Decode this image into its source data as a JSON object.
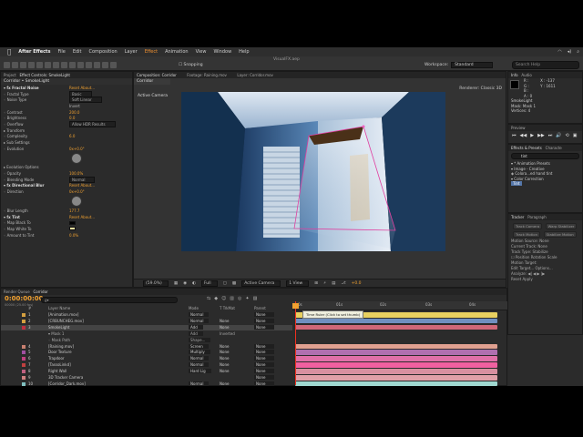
{
  "menubar": {
    "app_name": "After Effects",
    "items": [
      "File",
      "Edit",
      "Composition",
      "Layer",
      "Effect",
      "Animation",
      "View",
      "Window",
      "Help"
    ]
  },
  "toolbar": {
    "project_title": "VisualFX.aep",
    "snapping_label": "Snapping",
    "workspace_label": "Workspace:",
    "workspace_value": "Standard",
    "search_placeholder": "Search Help"
  },
  "project_panel": {
    "tabs": [
      "Project",
      "Effect Controls: SmokeLight"
    ],
    "subtitle": "Corridor • SmokeLight",
    "rows": [
      {
        "k": "▾ fx  Fractal Noise",
        "v": "Reset   About...",
        "t": "sec"
      },
      {
        "k": "   ◦ Fractal Type",
        "v": "Basic",
        "t": "drop"
      },
      {
        "k": "   ◦ Noise Type",
        "v": "Soft Linear",
        "t": "drop"
      },
      {
        "k": "",
        "v": "Invert",
        "t": "chk"
      },
      {
        "k": "   ◦ Contrast",
        "v": "200.0",
        "t": "val"
      },
      {
        "k": "   ◦ Brightness",
        "v": "0.0",
        "t": "val"
      },
      {
        "k": "   ◦ Overflow",
        "v": "Allow HDR Results",
        "t": "drop"
      },
      {
        "k": "▸ Transform",
        "v": "",
        "t": "txt"
      },
      {
        "k": "   ◦ Complexity",
        "v": "6.0",
        "t": "val"
      },
      {
        "k": "▸ Sub Settings",
        "v": "",
        "t": "txt"
      },
      {
        "k": "   ◦ Evolution",
        "v": "0x+0.0°",
        "t": "val"
      },
      {
        "k": "",
        "v": "",
        "t": "dial"
      },
      {
        "k": "▸ Evolution Options",
        "v": "",
        "t": "txt"
      },
      {
        "k": "   ◦ Opacity",
        "v": "100.0%",
        "t": "val"
      },
      {
        "k": "   ◦ Blending Mode",
        "v": "Normal",
        "t": "drop"
      },
      {
        "k": "▾ fx  Directional Blur",
        "v": "Reset   About...",
        "t": "sec"
      },
      {
        "k": "   ◦ Direction",
        "v": "0x+0.0°",
        "t": "val"
      },
      {
        "k": "",
        "v": "",
        "t": "dial"
      },
      {
        "k": "   ◦ Blur Length",
        "v": "177.7",
        "t": "val"
      },
      {
        "k": "▾ fx  Tint",
        "v": "Reset   About...",
        "t": "sec"
      },
      {
        "k": "   ◦ Map Black To",
        "v": "",
        "t": "swb"
      },
      {
        "k": "   ◦ Map White To",
        "v": "",
        "t": "sww"
      },
      {
        "k": "   ◦ Amount to Tint",
        "v": "0.0%",
        "t": "val"
      }
    ]
  },
  "viewer": {
    "tabs": [
      "Composition: Corridor",
      "Footage: Raining.mov",
      "Layer: Corridor.mov"
    ],
    "subtab": "Corridor",
    "active_camera": "Active Camera",
    "renderer": "Renderer:  Classic 3D",
    "bottom": [
      "(59.0%)",
      "Full",
      "Active Camera",
      "1 View",
      "+0.0"
    ]
  },
  "info_panel": {
    "tabs": [
      "Info",
      "Audio"
    ],
    "rows": [
      "R :",
      "G :",
      "B :",
      "A : 0",
      "X : -137",
      "Y : 1611",
      "SmokeLight",
      "Mask: Mask 1",
      "Vertices: 4"
    ]
  },
  "preview_panel": {
    "tab": "Preview",
    "controls": [
      "⏮",
      "◀◀",
      "▶",
      "▶▶",
      "⏭",
      "🔊",
      "⟲",
      "▣"
    ]
  },
  "effects_panel": {
    "tabs": [
      "Effects & Presets",
      "Characte"
    ],
    "search_value": "tint",
    "tree": [
      {
        "text": "▾ * Animation Presets",
        "sel": false
      },
      {
        "text": "   ▾ Image - Creative",
        "sel": false
      },
      {
        "text": "       ◈ Colora...ed hand tint",
        "sel": false
      },
      {
        "text": "▾ Color Correction",
        "sel": false
      },
      {
        "text": "   Tint",
        "sel": true
      }
    ]
  },
  "tracker_panel": {
    "tabs": [
      "Tracker",
      "Paragraph"
    ],
    "buttons": [
      "Track Camera",
      "Warp Stabilizer",
      "Track Motion",
      "Stabilize Motion"
    ],
    "rows": [
      "Motion Source:  None",
      "Current Track:  None",
      "Track Type:  Stabilize",
      "☐ Position   Rotation   Scale",
      "Motion Target:",
      "Edit Target...   Options...",
      "Analyze:  ◀|  ◀  ▶  |▶",
      "Reset         Apply"
    ]
  },
  "timeline": {
    "tabs": [
      "Render Queue",
      "Corridor"
    ],
    "timecode": "0:00:00:00",
    "frame_label": "00000 (25.00 fps)",
    "search_placeholder": "ϱ▾",
    "columns": [
      "#",
      "Layer Name",
      "Mode",
      "T TrkMat",
      "Parent"
    ],
    "ruler_ticks": [
      "0s",
      "01s",
      "02s",
      "03s",
      "04s"
    ],
    "tooltip": "Time Ruler (Click to set thumb)",
    "layers": [
      {
        "num": "1",
        "name": "[Animation.mov]",
        "mode": "Normal",
        "trk": "",
        "parent": "None",
        "label": "#d4a040",
        "bar": "#e8d060",
        "sel": false,
        "sub": false
      },
      {
        "num": "2",
        "name": "[CRBUNCHEG.mov]",
        "mode": "Normal",
        "trk": "None",
        "parent": "None",
        "label": "#d4a040",
        "bar": "#7090c0",
        "sel": false,
        "sub": false
      },
      {
        "num": "3",
        "name": "SmokeLight",
        "mode": "Add",
        "trk": "None",
        "parent": "None",
        "label": "#c03040",
        "bar": "#d06878",
        "sel": true,
        "sub": false
      },
      {
        "num": "",
        "name": "▾ Mask 1",
        "mode": "Add",
        "trk": "Inverted",
        "parent": "",
        "label": "",
        "bar": "",
        "sel": false,
        "sub": true
      },
      {
        "num": "",
        "name": "   ◦ Mask Path",
        "mode": "Shape...",
        "trk": "",
        "parent": "",
        "label": "",
        "bar": "",
        "sel": false,
        "sub": true
      },
      {
        "num": "4",
        "name": "[Raining.mov]",
        "mode": "Screen",
        "trk": "None",
        "parent": "None",
        "label": "#c88070",
        "bar": "#e0a090",
        "sel": false,
        "sub": false
      },
      {
        "num": "5",
        "name": "Door Texture",
        "mode": "Multiply",
        "trk": "None",
        "parent": "None",
        "label": "#a050a0",
        "bar": "#b070b0",
        "sel": false,
        "sub": false
      },
      {
        "num": "6",
        "name": "Trapdoor",
        "mode": "Normal",
        "trk": "None",
        "parent": "None",
        "label": "#c04080",
        "bar": "#e070a8",
        "sel": false,
        "sub": false
      },
      {
        "num": "7",
        "name": "[TassoLinkd]",
        "mode": "Normal",
        "trk": "None",
        "parent": "None",
        "label": "#c04040",
        "bar": "#f060a0",
        "sel": false,
        "sub": false
      },
      {
        "num": "8",
        "name": "Right Wall",
        "mode": "Hard Lig",
        "trk": "None",
        "parent": "None",
        "label": "#c06080",
        "bar": "#d890a0",
        "sel": false,
        "sub": false
      },
      {
        "num": "9",
        "name": "3D Tracker Camera",
        "mode": "",
        "trk": "",
        "parent": "None",
        "label": "#d08080",
        "bar": "#e0a0a8",
        "sel": false,
        "sub": false
      },
      {
        "num": "10",
        "name": "[Corridor_Dark.mov]",
        "mode": "Normal",
        "trk": "None",
        "parent": "None",
        "label": "#80c0c0",
        "bar": "#a0d8d0",
        "sel": false,
        "sub": false
      },
      {
        "num": "11",
        "name": "[Corridor.mov]",
        "mode": "Normal",
        "trk": "None",
        "parent": "None",
        "label": "#80c0c0",
        "bar": "#a0d8d0",
        "sel": false,
        "sub": false
      }
    ]
  },
  "colors": {
    "accent": "#f0a030",
    "panel_bg": "#2b2b2b",
    "playhead": "#f03020"
  }
}
